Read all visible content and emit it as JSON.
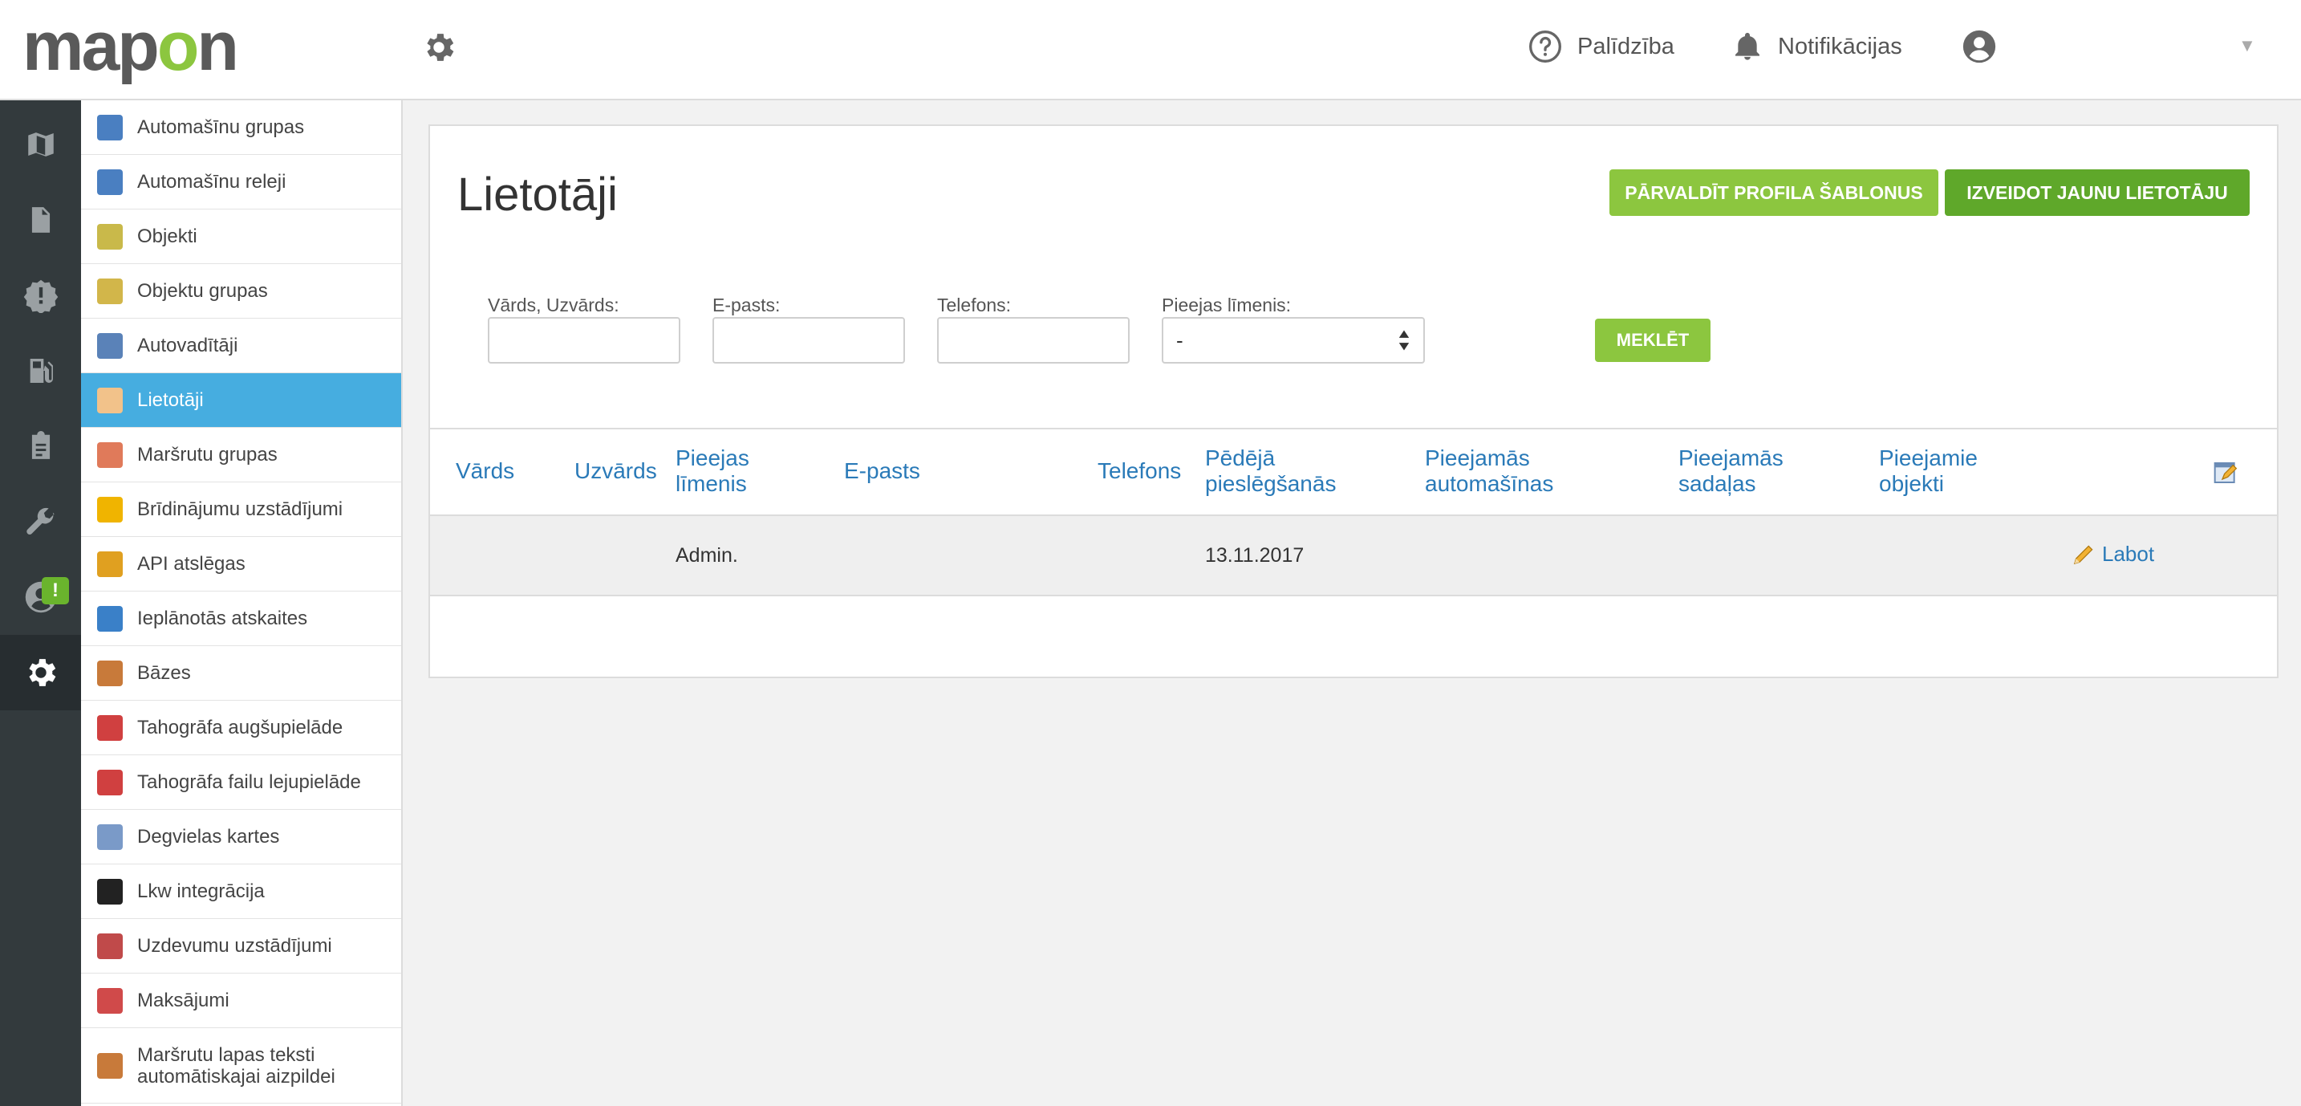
{
  "header": {
    "logo_text": "mapon",
    "help_label": "Palīdzība",
    "notifications_label": "Notifikācijas",
    "caret": "▼"
  },
  "rail": {
    "badge": "!"
  },
  "menu": {
    "items": [
      {
        "label": "Automašīnu grupas",
        "icon": "car-group-icon",
        "color": "#4a7fc1"
      },
      {
        "label": "Automašīnu releji",
        "icon": "car-relay-icon",
        "color": "#4a7fc1"
      },
      {
        "label": "Objekti",
        "icon": "objects-icon",
        "color": "#c9b94a"
      },
      {
        "label": "Objektu grupas",
        "icon": "object-groups-icon",
        "color": "#d2b64a"
      },
      {
        "label": "Autovadītāji",
        "icon": "drivers-icon",
        "color": "#5a82b8"
      },
      {
        "label": "Lietotāji",
        "icon": "users-icon",
        "color": "#f2c28a"
      },
      {
        "label": "Maršrutu grupas",
        "icon": "route-groups-icon",
        "color": "#e07a5a"
      },
      {
        "label": "Brīdinājumu uzstādījumi",
        "icon": "warning-icon",
        "color": "#f0b400"
      },
      {
        "label": "API atslēgas",
        "icon": "key-icon",
        "color": "#e0a020"
      },
      {
        "label": "Ieplānotās atskaites",
        "icon": "alarm-clock-icon",
        "color": "#3a80c8"
      },
      {
        "label": "Bāzes",
        "icon": "house-icon",
        "color": "#c87a3a"
      },
      {
        "label": "Tahogrāfa augšupielāde",
        "icon": "tachograph-upload-icon",
        "color": "#d04040"
      },
      {
        "label": "Tahogrāfa failu lejupielāde",
        "icon": "tachograph-download-icon",
        "color": "#d04040"
      },
      {
        "label": "Degvielas kartes",
        "icon": "fuel-cards-icon",
        "color": "#7a9ac8"
      },
      {
        "label": "Lkw integrācija",
        "icon": "lkw-icon",
        "color": "#222222"
      },
      {
        "label": "Uzdevumu uzstādījumi",
        "icon": "tasks-icon",
        "color": "#c04a4a"
      },
      {
        "label": "Maksājumi",
        "icon": "payments-icon",
        "color": "#d04a4a"
      },
      {
        "label": "Maršrutu lapas teksti automātiskajai aizpildei",
        "icon": "route-sheet-icon",
        "color": "#c87a3a"
      }
    ],
    "active_index": 5
  },
  "main": {
    "title": "Lietotāji",
    "btn_templates": "PĀRVALDĪT PROFILA ŠABLONUS",
    "btn_create": "IZVEIDOT JAUNU LIETOTĀJU",
    "filters": {
      "name_label": "Vārds, Uzvārds:",
      "email_label": "E-pasts:",
      "phone_label": "Telefons:",
      "access_label": "Pieejas līmenis:",
      "name_value": "",
      "email_value": "",
      "phone_value": "",
      "access_value": "-",
      "search_label": "MEKLĒT"
    },
    "table": {
      "headers": {
        "first_name": "Vārds",
        "last_name": "Uzvārds",
        "access_level_1": "Pieejas",
        "access_level_2": "līmenis",
        "email": "E-pasts",
        "phone": "Telefons",
        "last_login_1": "Pēdējā",
        "last_login_2": "pieslēgšanās",
        "cars_1": "Pieejamās",
        "cars_2": "automašīnas",
        "sections_1": "Pieejamās",
        "sections_2": "sadaļas",
        "objects_1": "Pieejamie",
        "objects_2": "objekti"
      },
      "rows": [
        {
          "first_name": "",
          "last_name": "",
          "access_level": "Admin.",
          "email": "",
          "phone": "",
          "last_login": "13.11.2017",
          "edit_label": "Labot"
        }
      ]
    }
  },
  "colors": {
    "brand_green": "#8cc63f",
    "dark_green": "#5fa82a",
    "active_blue": "#46ade0",
    "link_blue": "#2a7ab8",
    "rail_dark": "#333a3d"
  }
}
